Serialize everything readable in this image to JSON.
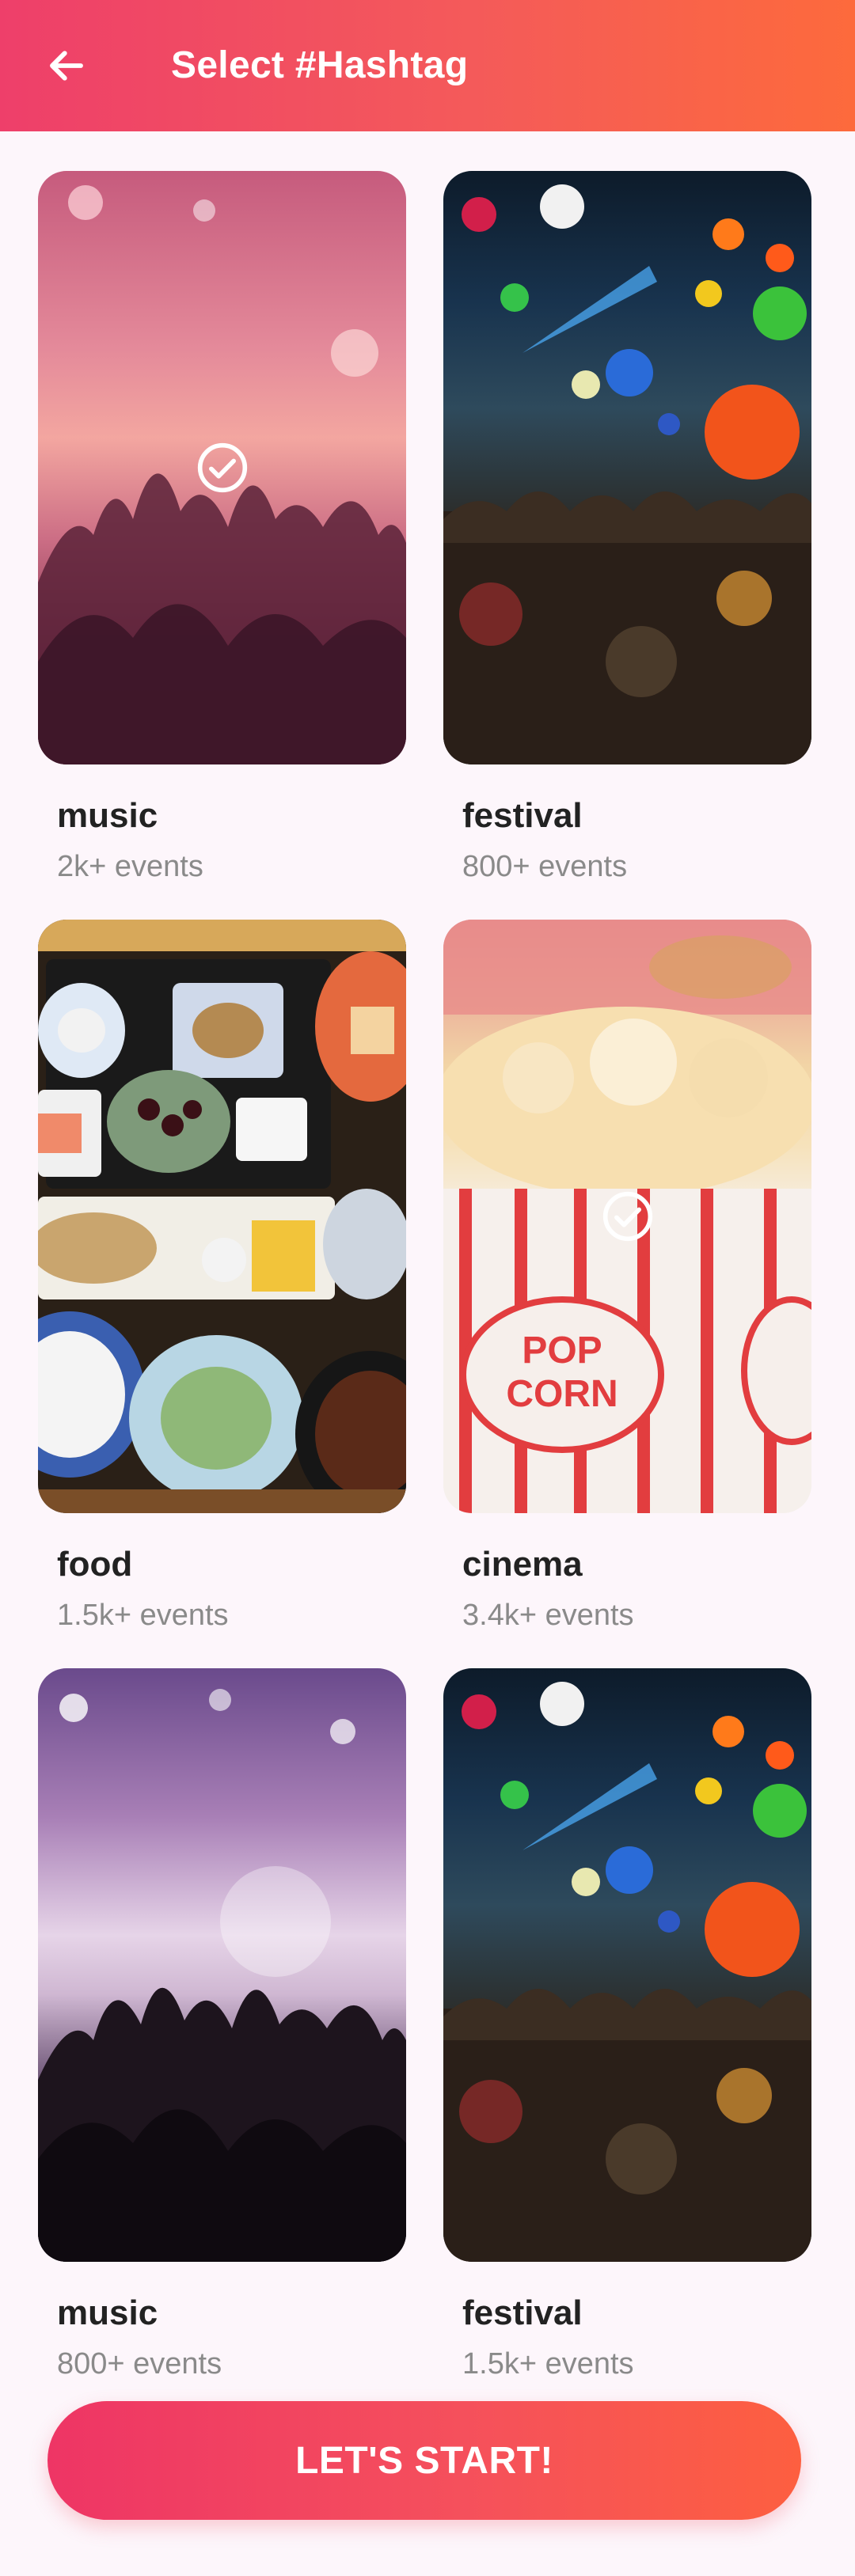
{
  "app_bar": {
    "title": "Select #Hashtag",
    "back_icon": "arrow-left-icon",
    "gradient": [
      "#ee3f6a",
      "#fd6a3c"
    ]
  },
  "hashtags": [
    {
      "name": "music",
      "count": "2k+ events",
      "selected": true,
      "image": "concert-crowd-pink-photo"
    },
    {
      "name": "festival",
      "count": "800+ events",
      "selected": false,
      "image": "festival-balloons-photo"
    },
    {
      "name": "food",
      "count": "1.5k+ events",
      "selected": false,
      "image": "japanese-bento-photo"
    },
    {
      "name": "cinema",
      "count": "3.4k+ events",
      "selected": true,
      "image": "popcorn-box-photo"
    },
    {
      "name": "music",
      "count": "800+ events",
      "selected": false,
      "image": "concert-crowd-violet-photo"
    },
    {
      "name": "festival",
      "count": "1.5k+ events",
      "selected": false,
      "image": "festival-balloons-photo"
    }
  ],
  "cta": {
    "label": "LET'S START!",
    "color": "#f24a5f"
  }
}
